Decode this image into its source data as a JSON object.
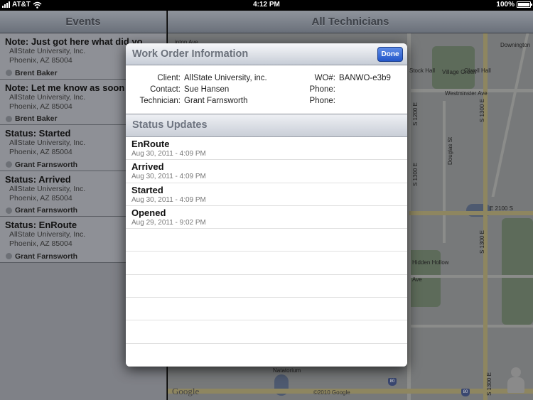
{
  "status_bar": {
    "carrier": "AT&T",
    "time": "4:12 PM",
    "battery": "100%"
  },
  "events_pane": {
    "title": "Events",
    "items": [
      {
        "title": "Note: Just got here what did yo",
        "company": "AllState University, Inc.",
        "location": "Phoenix, AZ 85004",
        "technician": "Brent Baker"
      },
      {
        "title": "Note: Let me know as soon",
        "company": "AllState University, Inc.",
        "location": "Phoenix, AZ 85004",
        "technician": "Brent Baker"
      },
      {
        "title": "Status: Started",
        "company": "AllState University, Inc.",
        "location": "Phoenix, AZ 85004",
        "technician": "Grant Farnsworth"
      },
      {
        "title": "Status: Arrived",
        "company": "AllState University, Inc.",
        "location": "Phoenix, AZ 85004",
        "technician": "Grant Farnsworth"
      },
      {
        "title": "Status: EnRoute",
        "company": "AllState University, Inc.",
        "location": "Phoenix, AZ 85004",
        "technician": "Grant Farnsworth"
      }
    ]
  },
  "map_pane": {
    "title": "All Technicians",
    "labels": {
      "downington": "Downington",
      "stock_hall": "Stock Hall",
      "village_green": "Village Green",
      "olwell_hall": "Olwell Hall",
      "westminster": "Westminster Ave",
      "s1200e": "S 1200 E",
      "s1300e": "S 1300 E",
      "douglas": "Douglas St",
      "e2100s": "E 2100 S",
      "hidden_hollow": "Hidden Hollow",
      "ave": "Ave",
      "natatorium": "Natatorium",
      "inton_ave": "inton Ave",
      "hwy80": "80",
      "google": "Google",
      "copyright": "©2010 Google"
    }
  },
  "modal": {
    "title": "Work Order Information",
    "done_label": "Done",
    "client_label": "Client:",
    "client": "AllState University, inc.",
    "contact_label": "Contact:",
    "contact": "Sue Hansen",
    "technician_label": "Technician:",
    "technician": "Grant Farnsworth",
    "wo_label": "WO#:",
    "wo": "BANWO-e3b9",
    "phone_label": "Phone:",
    "phone": "",
    "phone2": "",
    "section_title": "Status Updates",
    "updates": [
      {
        "status": "EnRoute",
        "date": "Aug 30, 2011 - 4:09 PM"
      },
      {
        "status": "Arrived",
        "date": "Aug 30, 2011 - 4:09 PM"
      },
      {
        "status": "Started",
        "date": "Aug 30, 2011 - 4:09 PM"
      },
      {
        "status": "Opened",
        "date": "Aug 29, 2011 - 9:02 PM"
      }
    ]
  }
}
